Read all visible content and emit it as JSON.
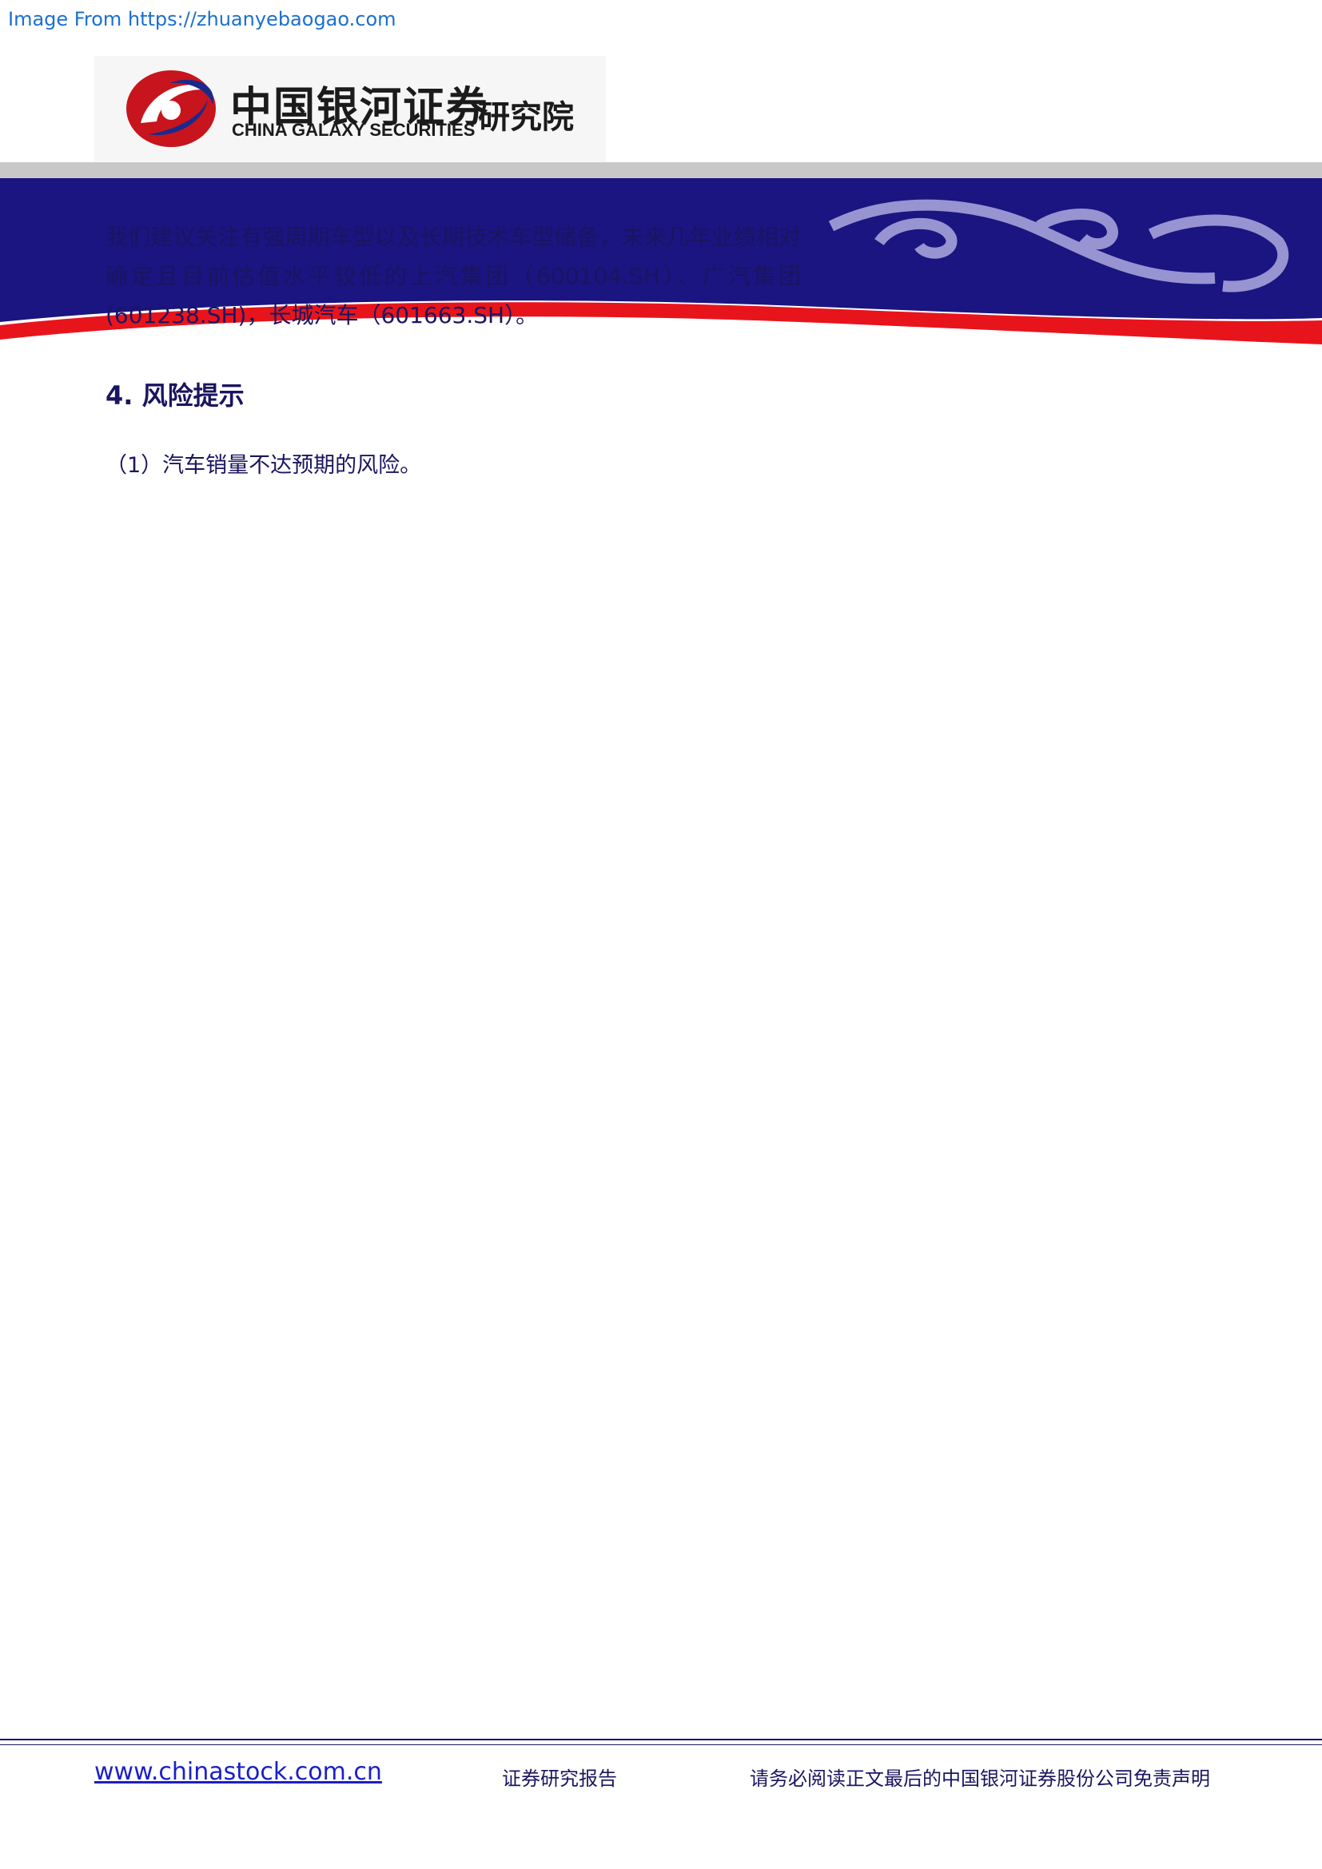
{
  "watermark": "Image From https://zhuanyebaogao.com",
  "logo": {
    "cn_name": "中国银河证券",
    "en_name": "CHINA GALAXY SECURITIES",
    "institute": "研究院"
  },
  "body": {
    "paragraph": "我们建议关注有强周期车型以及长期技术车型储备，未来几年业绩相对确定且目前估值水平较低的上汽集团（600104.SH）、广汽集团(601238.SH)，长城汽车（601663.SH）。"
  },
  "section": {
    "title": "4. 风险提示",
    "items": [
      "（1）汽车销量不达预期的风险。"
    ]
  },
  "footer": {
    "website": "www.chinastock.com.cn",
    "report_type": "证券研究报告",
    "disclaimer": "请务必阅读正文最后的中国银河证券股份公司免责声明"
  },
  "colors": {
    "navy": "#1a1580",
    "red": "#e8141c",
    "text": "#1a1560"
  }
}
